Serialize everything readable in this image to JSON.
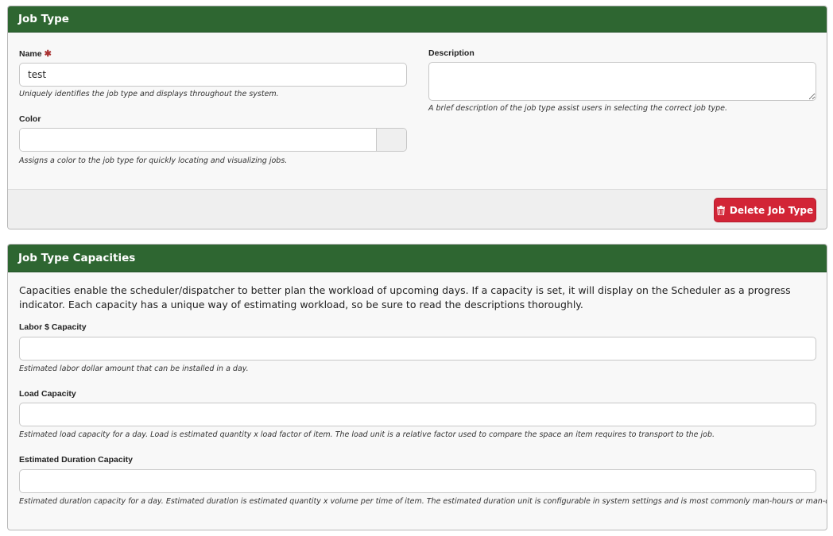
{
  "job_type_panel": {
    "title": "Job Type",
    "name": {
      "label": "Name",
      "required_marker": "✱",
      "value": "test",
      "help": "Uniquely identifies the job type and displays throughout the system."
    },
    "description": {
      "label": "Description",
      "value": "",
      "help": "A brief description of the job type assist users in selecting the correct job type."
    },
    "color": {
      "label": "Color",
      "value": "",
      "help": "Assigns a color to the job type for quickly locating and visualizing jobs."
    },
    "delete_button": {
      "label": "Delete Job Type",
      "icon": "trash-icon",
      "color": "#d22436"
    }
  },
  "capacities_panel": {
    "title": "Job Type Capacities",
    "intro": "Capacities enable the scheduler/dispatcher to better plan the workload of upcoming days. If a capacity is set, it will display on the Scheduler as a progress indicator. Each capacity has a unique way of estimating workload, so be sure to read the descriptions thoroughly.",
    "labor": {
      "label": "Labor $ Capacity",
      "value": "",
      "help": "Estimated labor dollar amount that can be installed in a day."
    },
    "load": {
      "label": "Load Capacity",
      "value": "",
      "help": "Estimated load capacity for a day. Load is estimated quantity x load factor of item. The load unit is a relative factor used to compare the space an item requires to transport to the job."
    },
    "duration": {
      "label": "Estimated Duration Capacity",
      "value": "",
      "help": "Estimated duration capacity for a day. Estimated duration is estimated quantity x volume per time of item. The estimated duration unit is configurable in system settings and is most commonly man-hours or man-days."
    }
  },
  "colors": {
    "header_green": "#2e6631",
    "danger_red": "#d22436",
    "required_red": "#aa3333"
  }
}
